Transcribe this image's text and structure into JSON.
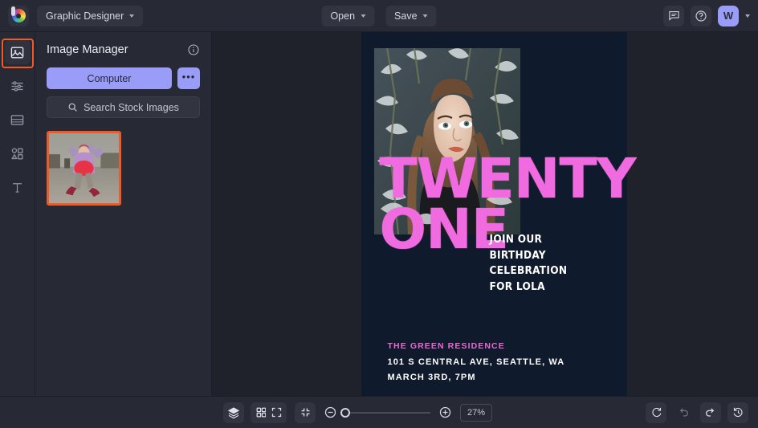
{
  "topbar": {
    "logo_name": "colorwheel-logo",
    "workspace": "Graphic Designer",
    "open_label": "Open",
    "save_label": "Save",
    "feedback_icon": "chat-icon",
    "help_icon": "help-icon",
    "avatar_initial": "W"
  },
  "rail": {
    "items": [
      {
        "name": "image-manager",
        "icon": "image-icon",
        "active": true
      },
      {
        "name": "adjustments",
        "icon": "sliders-icon",
        "active": false
      },
      {
        "name": "layouts",
        "icon": "layout-icon",
        "active": false
      },
      {
        "name": "shapes",
        "icon": "shapes-icon",
        "active": false
      },
      {
        "name": "text",
        "icon": "text-icon",
        "active": false
      }
    ]
  },
  "panel": {
    "title": "Image Manager",
    "info_icon": "info-icon",
    "computer_label": "Computer",
    "more_label": "•••",
    "search_placeholder": "Search Stock Images",
    "search_value": "Search Stock Images",
    "thumbnail_name": "uploaded-image-thumbnail"
  },
  "poster": {
    "headline_line1": "TWENTY",
    "headline_line2": "ONE",
    "sub_line1": "JOIN OUR",
    "sub_line2": "BIRTHDAY",
    "sub_line3": "CELEBRATION",
    "sub_line4": "FOR LOLA",
    "venue": "THE GREEN RESIDENCE",
    "address": "101 S CENTRAL AVE, SEATTLE, WA",
    "datetime": "MARCH 3RD, 7PM",
    "accent_color": "#f06ae0",
    "background_color": "#101a2d"
  },
  "bottombar": {
    "layers_icon": "layers-icon",
    "grid_icon": "grid-icon",
    "fit_icon": "fit-screen-icon",
    "shrink_icon": "collapse-icon",
    "zoom_out_icon": "zoom-out-icon",
    "zoom_in_icon": "zoom-in-icon",
    "zoom_value": "27%",
    "reset_icon": "reset-icon",
    "undo_icon": "undo-icon",
    "redo_icon": "redo-icon",
    "history_icon": "history-icon"
  }
}
